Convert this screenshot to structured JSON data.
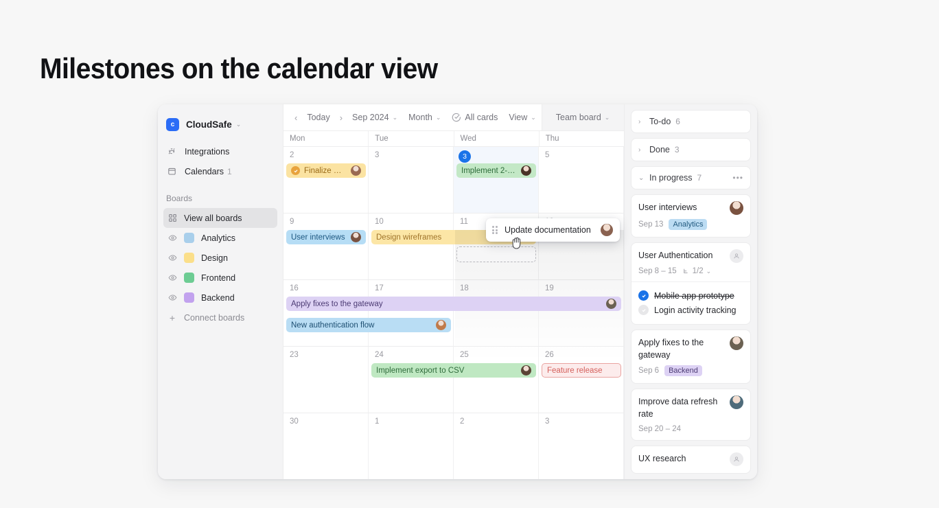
{
  "page": {
    "title": "Milestones on the calendar view"
  },
  "sidebar": {
    "brand": {
      "logo_letter": "c",
      "name": "CloudSafe",
      "caret": "⌄"
    },
    "nav": [
      {
        "icon": "integrations-icon",
        "label": "Integrations",
        "count": ""
      },
      {
        "icon": "calendar-icon",
        "label": "Calendars",
        "count": "1"
      }
    ],
    "section_label": "Boards",
    "view_all": {
      "label": "View all boards",
      "icon": "grid-icon"
    },
    "boards": [
      {
        "label": "Analytics",
        "color": "#a9cfeb"
      },
      {
        "label": "Design",
        "color": "#fbdf8a"
      },
      {
        "label": "Frontend",
        "color": "#6dcc93"
      },
      {
        "label": "Backend",
        "color": "#c2a2ee"
      }
    ],
    "connect": {
      "label": "Connect boards",
      "icon": "plus-icon"
    }
  },
  "toolbar": {
    "prev": "‹",
    "today": "Today",
    "next": "›",
    "month_year": "Sep 2024",
    "view_scale": "Month",
    "filter": "All cards",
    "view": "View",
    "board": "Team board",
    "panel_toggle": "panel-toggle-icon"
  },
  "calendar": {
    "weekdays": [
      "Mon",
      "Tue",
      "Wed",
      "Thu"
    ],
    "weeks": [
      {
        "days": [
          {
            "num": "2",
            "today": false
          },
          {
            "num": "3",
            "today": false
          },
          {
            "num": "3",
            "today": true
          },
          {
            "num": "5",
            "today": false
          }
        ],
        "events": [
          {
            "label": "Finalize w…",
            "color_class": "c-yellow",
            "start": 0,
            "span": 1,
            "row": 0,
            "milestone_dot": true,
            "avatar": "#9a6a52"
          }
        ]
      },
      {
        "days": [
          {
            "num": "9",
            "today": false
          },
          {
            "num": "10",
            "today": false
          },
          {
            "num": "11",
            "today": false
          },
          {
            "num": "12",
            "today": false
          }
        ],
        "events": [
          {
            "label": "User interviews",
            "color_class": "c-blue",
            "start": 0,
            "span": 1,
            "row": 0,
            "avatar": "#7a5240"
          },
          {
            "label": "Design wireframes",
            "color_class": "c-yellow2",
            "start": 1,
            "span": 2,
            "row": 0,
            "avatar": ""
          }
        ]
      },
      {
        "days": [
          {
            "num": "16",
            "today": false
          },
          {
            "num": "17",
            "today": false
          },
          {
            "num": "18",
            "today": false
          },
          {
            "num": "19",
            "today": false
          }
        ],
        "events": [
          {
            "label": "Apply fixes to the gateway",
            "color_class": "c-purple",
            "start": 0,
            "span": 4,
            "row": 0,
            "avatar": "#6b6152"
          },
          {
            "label": "New authentication flow",
            "color_class": "c-blue2",
            "start": 0,
            "span": 2,
            "row": 1,
            "avatar": "#c07a4a"
          }
        ]
      },
      {
        "days": [
          {
            "num": "23",
            "today": false
          },
          {
            "num": "24",
            "today": false
          },
          {
            "num": "25",
            "today": false
          },
          {
            "num": "26",
            "today": false
          }
        ],
        "events": [
          {
            "label": "Implement export to CSV",
            "color_class": "c-green2",
            "start": 1,
            "span": 2,
            "row": 0,
            "avatar": "#5b4436"
          },
          {
            "label": "Feature release",
            "color_class": "c-milestone",
            "start": 3,
            "span": 1,
            "row": 0,
            "avatar": ""
          }
        ]
      },
      {
        "days": [
          {
            "num": "30",
            "today": false
          },
          {
            "num": "1",
            "today": false
          },
          {
            "num": "2",
            "today": false
          },
          {
            "num": "3",
            "today": false
          }
        ],
        "events": []
      }
    ],
    "week1_extra_event": {
      "label": "Implement 2-f…",
      "color_class": "c-green",
      "avatar": "#4a3328"
    },
    "drag_card": {
      "label": "Update documentation",
      "handle": "drag-handle-icon",
      "avatar": "#8a6250",
      "cursor": "grabbing-hand-cursor"
    }
  },
  "right_panel": {
    "groups": [
      {
        "label": "To-do",
        "count": "6",
        "expanded": false,
        "chev": "›"
      },
      {
        "label": "Done",
        "count": "3",
        "expanded": false,
        "chev": "›"
      },
      {
        "label": "In progress",
        "count": "7",
        "expanded": true,
        "chev": "⌄",
        "menu": "•••"
      }
    ],
    "cards": [
      {
        "title": "User interviews",
        "date": "Sep 13",
        "tag": {
          "label": "Analytics",
          "class": "analytics"
        },
        "avatar": "#7a5240"
      },
      {
        "title": "User Authentication",
        "date": "Sep 8 – 15",
        "subtasks": "1/2",
        "avatar_empty": true,
        "checklist": [
          {
            "label": "Mobile app prototype",
            "done": true
          },
          {
            "label": "Login activity tracking",
            "done": false
          }
        ]
      },
      {
        "title": "Apply fixes to the gateway",
        "date": "Sep 6",
        "tag": {
          "label": "Backend",
          "class": "backend"
        },
        "avatar": "#6b6152"
      },
      {
        "title": "Improve data refresh rate",
        "date": "Sep 20 – 24",
        "avatar": "#4e6b7a"
      },
      {
        "title": "UX research",
        "date": "",
        "avatar_empty": true
      }
    ]
  }
}
